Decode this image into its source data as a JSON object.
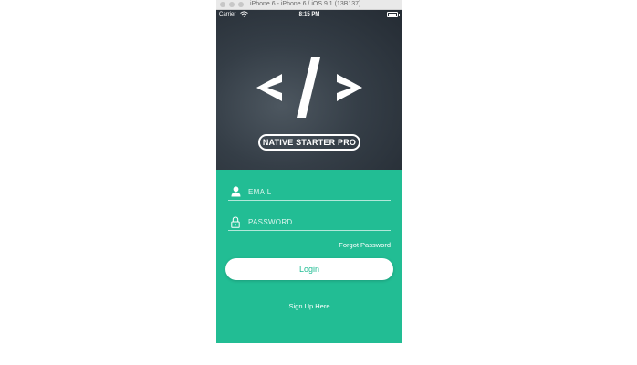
{
  "simulator": {
    "title": "iPhone 6 - iPhone 6 / iOS 9.1 (13B137)"
  },
  "status_bar": {
    "carrier": "Carrier",
    "time": "8:15 PM"
  },
  "brand": {
    "logo_icon": "code-brackets-icon",
    "name": "NATIVE STARTER PRO"
  },
  "form": {
    "email_placeholder": "EMAIL",
    "password_placeholder": "PASSWORD",
    "forgot_password": "Forgot Password",
    "login_label": "Login",
    "signup_label": "Sign Up Here"
  },
  "colors": {
    "accent": "#22bd94",
    "hero_dark": "#242b33",
    "text_light": "#ffffff"
  }
}
